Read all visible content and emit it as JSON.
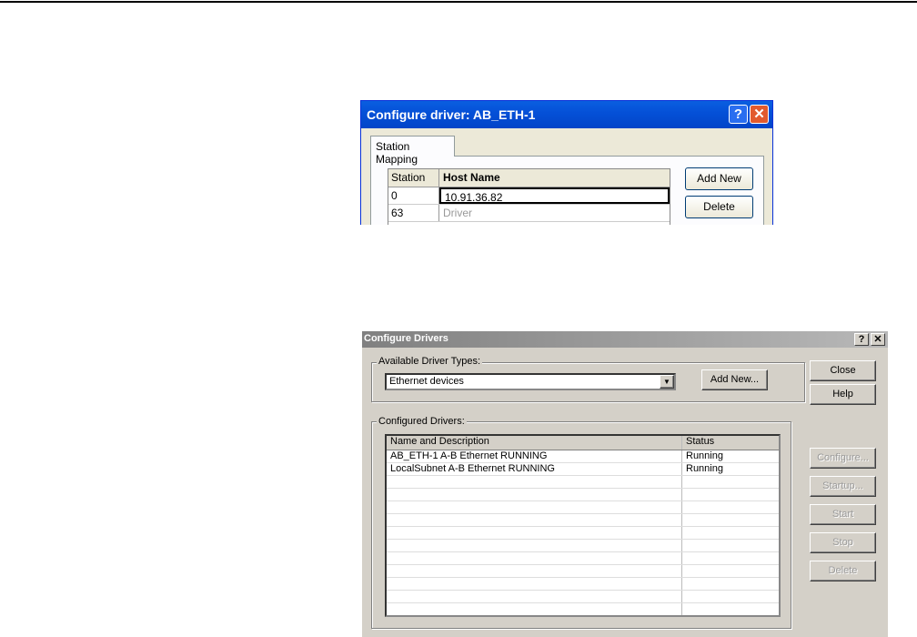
{
  "dialog1": {
    "title": "Configure driver: AB_ETH-1",
    "help": "?",
    "close": "✕",
    "tab": "Station Mapping",
    "columns": [
      "Station",
      "Host Name"
    ],
    "rows": [
      {
        "station": "0",
        "host": "10.91.36.82"
      },
      {
        "station": "63",
        "host": "Driver"
      }
    ],
    "add_new": "Add New",
    "delete": "Delete"
  },
  "dialog2": {
    "title": "Configure Drivers",
    "help": "?",
    "close": "✕",
    "available_label": "Available Driver Types:",
    "driver_type": "Ethernet devices",
    "add_new": "Add New...",
    "close_btn": "Close",
    "help_btn": "Help",
    "configured_label": "Configured Drivers:",
    "columns": [
      "Name and Description",
      "Status"
    ],
    "rows": [
      {
        "name": "AB_ETH-1  A-B Ethernet  RUNNING",
        "status": "Running"
      },
      {
        "name": "LocalSubnet  A-B Ethernet  RUNNING",
        "status": "Running"
      }
    ],
    "configure": "Configure...",
    "startup": "Startup...",
    "start": "Start",
    "stop": "Stop",
    "delete": "Delete"
  }
}
